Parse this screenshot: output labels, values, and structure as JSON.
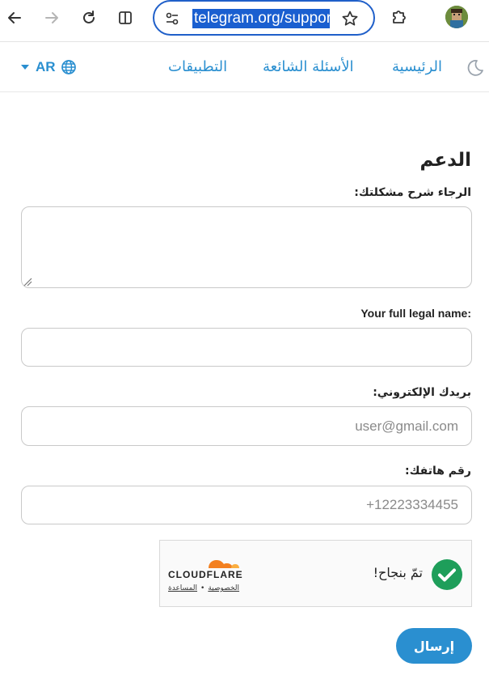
{
  "browser": {
    "url": "telegram.org/support"
  },
  "nav": {
    "lang": "AR",
    "links": [
      "الرئيسية",
      "الأسئلة الشائعة",
      "التطبيقات"
    ]
  },
  "form": {
    "title": "الدعم",
    "description_label": "الرجاء شرح مشكلتك:",
    "name_label": "Your full legal name:",
    "email_label": "بريدك الإلكتروني:",
    "email_placeholder": "user@gmail.com",
    "phone_label": "رقم هاتفك:",
    "phone_placeholder": "+12223334455",
    "submit_label": "إرسال"
  },
  "captcha": {
    "status": "تمّ بنجاح!",
    "brand": "CLOUDFLARE",
    "privacy_link": "الخصوصية",
    "separator": "•",
    "help_link": "المساعدة",
    "check_color": "#1e9e5a",
    "brand_color": "#f38020"
  },
  "colors": {
    "accent": "#2a8fd0",
    "url_highlight": "#1a5fd0"
  }
}
